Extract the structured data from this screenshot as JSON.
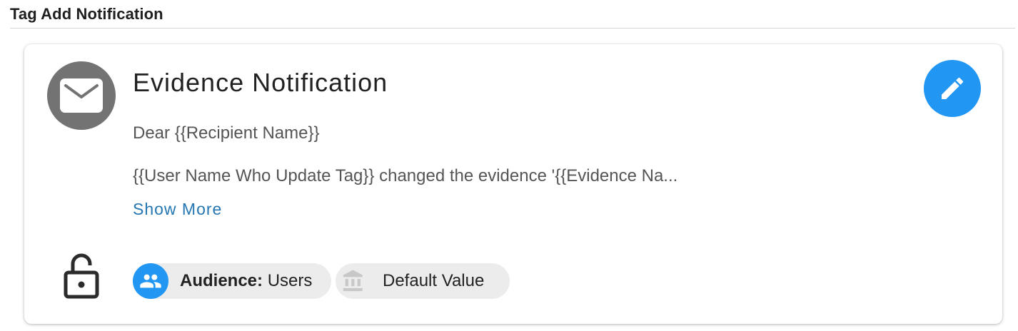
{
  "section": {
    "title": "Tag Add Notification"
  },
  "notification": {
    "title": "Evidence Notification",
    "greeting": "Dear {{Recipient Name}}",
    "body_preview": "{{User Name Who Update Tag}} changed the evidence '{{Evidence Na...",
    "show_more_label": "Show More",
    "icon": "mail-icon"
  },
  "actions": {
    "edit_icon": "pencil-icon"
  },
  "status": {
    "lock_icon": "unlocked-padlock-icon"
  },
  "chips": {
    "audience": {
      "label": "Audience:",
      "value": "Users",
      "icon": "group-icon"
    },
    "default": {
      "label": "Default Value",
      "icon": "bank-icon"
    }
  },
  "colors": {
    "accent": "#2196f3",
    "link": "#2577b3",
    "avatar_bg": "#737373",
    "chip_bg": "#ececec",
    "muted_icon": "#c8c8c8"
  }
}
